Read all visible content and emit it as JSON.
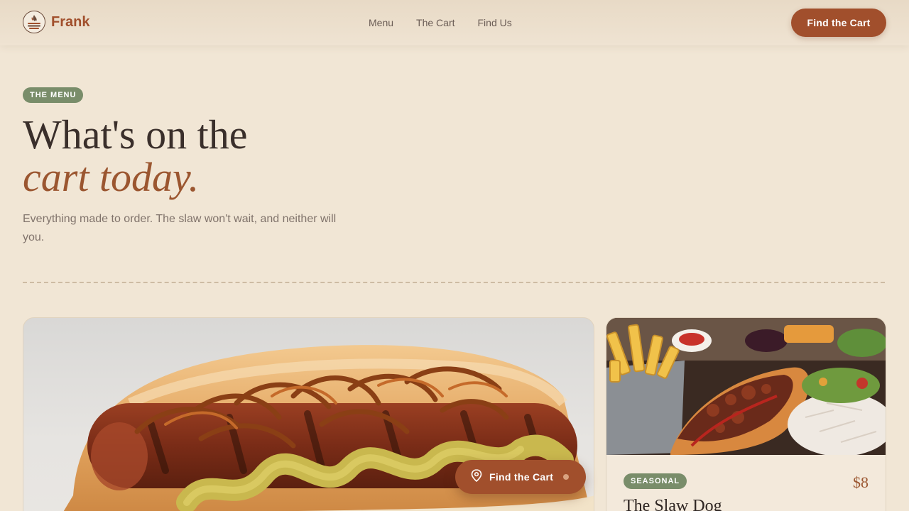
{
  "header": {
    "brand": "Frank",
    "logo_icon": "flame-grill-logo-icon",
    "nav": [
      "Menu",
      "The Cart",
      "Find Us"
    ],
    "cta_label": "Find the Cart"
  },
  "hero": {
    "pill": "THE MENU",
    "title_line1": "What's on the",
    "title_line2": "cart today.",
    "subtitle": "Everything made to order. The slaw won't wait, and neither will you."
  },
  "menu_items": [
    {
      "image": "grilled hot dog with caramelized onions and mustard",
      "tag": "",
      "price": "",
      "name": ""
    },
    {
      "image": "slaw dog with pulled meat, fries and salad",
      "tag": "SEASONAL",
      "price": "$8",
      "name": "The Slaw Dog"
    }
  ],
  "floating_cta": {
    "label": "Find the Cart",
    "icon": "map-pin-icon"
  },
  "colors": {
    "background": "#f1e6d5",
    "accent": "#a14f2c",
    "tag_green": "#798d6a",
    "text_dark": "#3a2f2b",
    "text_muted": "#80736b"
  }
}
